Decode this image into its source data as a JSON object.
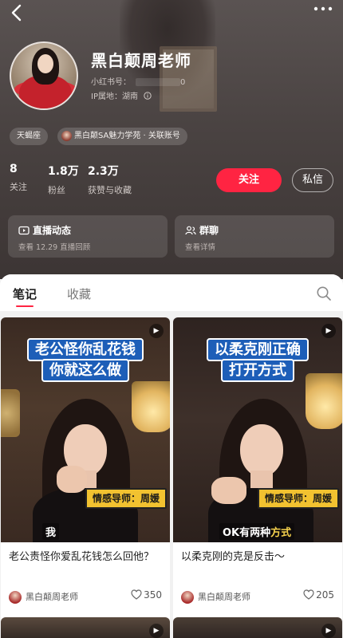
{
  "header": {
    "back_icon": "chevron-left-icon",
    "more_icon": "more-dots-icon",
    "name": "黑白颠周老师",
    "uid_label": "小红书号：",
    "uid_suffix": "0",
    "ip_label": "IP属地：湖南"
  },
  "tags": {
    "zodiac": "天蝎座",
    "linked": "黑白颠SA魅力学苑 · 关联账号"
  },
  "stats": {
    "following": {
      "num": "8",
      "label": "关注"
    },
    "followers": {
      "num": "1.8万",
      "label": "粉丝"
    },
    "likes": {
      "num": "2.3万",
      "label": "获赞与收藏"
    }
  },
  "actions": {
    "follow_label": "关注",
    "message_label": "私信"
  },
  "cards": {
    "live": {
      "title": "直播动态",
      "sub": "查看 12.29 直播回顾",
      "icon": "live-tv-icon"
    },
    "group": {
      "title": "群聊",
      "sub": "查看详情",
      "icon": "group-users-icon"
    }
  },
  "tabs": {
    "notes": "笔记",
    "collect": "收藏",
    "search_icon": "search-icon"
  },
  "notes": [
    {
      "cover_line1": "老公怪你乱花钱",
      "cover_line2": "你就这么做",
      "badge": "情感导师：周媛",
      "subtitle_a": "我",
      "subtitle_b": "",
      "title": "老公责怪你爱乱花钱怎么回他？",
      "author": "黑白颠周老师",
      "likes": "350"
    },
    {
      "cover_line1": "以柔克刚正确",
      "cover_line2": "打开方式",
      "badge": "情感导师：周媛",
      "subtitle_a": "OK有两种",
      "subtitle_b": "方式",
      "title": "以柔克刚的克是反击～",
      "author": "黑白颠周老师",
      "likes": "205"
    }
  ],
  "colors": {
    "accent": "#ff2442",
    "cover_title_bg": "#1d5eb8",
    "badge_yellow": "#f2c230"
  }
}
